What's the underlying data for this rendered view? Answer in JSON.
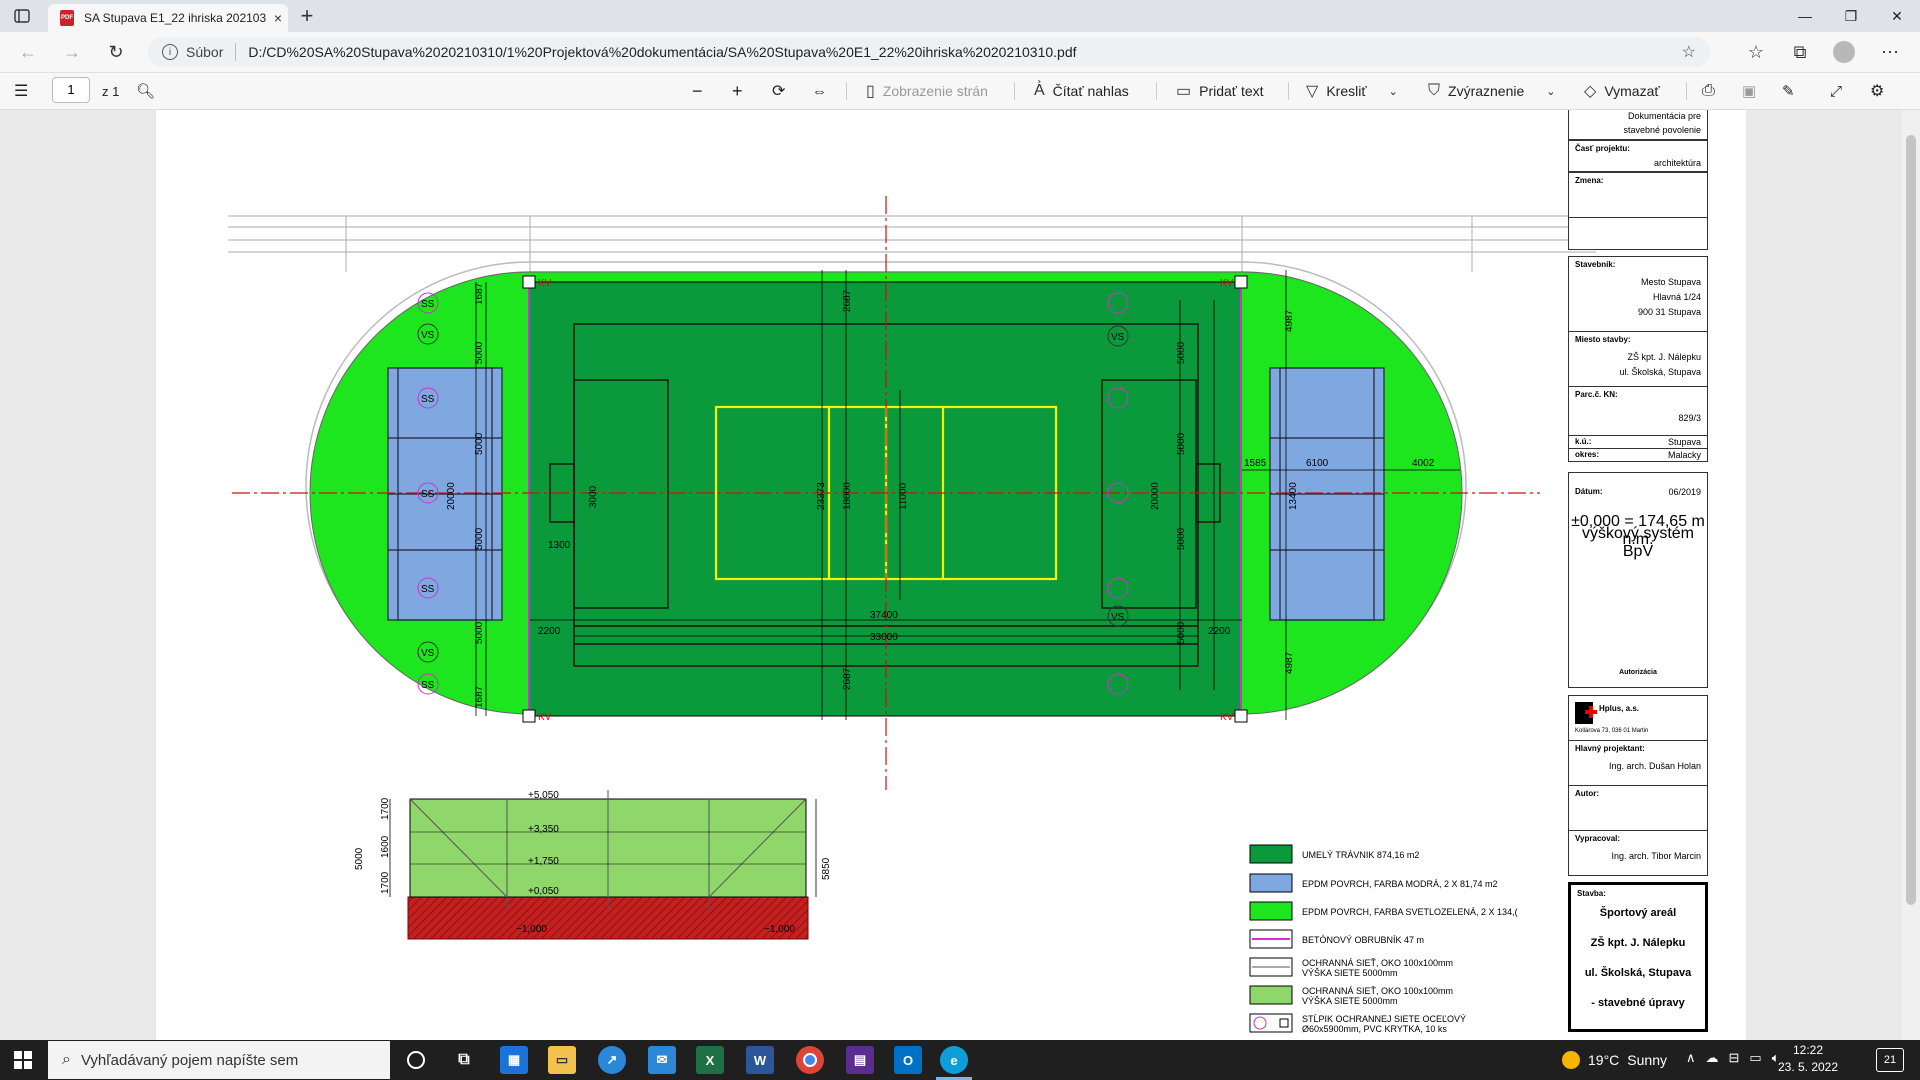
{
  "browser": {
    "tab_title": "SA Stupava E1_22 ihriska 202103",
    "tab_close": "×",
    "new_tab": "+",
    "url_label": "Súbor",
    "url": "D:/CD%20SA%20Stupava%2020210310/1%20Projektová%20dokumentácia/SA%20Stupava%20E1_22%20ihriska%2020210310.pdf"
  },
  "pdf_toolbar": {
    "page_number": "1",
    "page_total": "z 1",
    "page_view": "Zobrazenie strán",
    "read_aloud": "Čítať nahlas",
    "add_text": "Pridať text",
    "draw": "Kresliť",
    "highlight": "Zvýraznenie",
    "erase": "Vymazať"
  },
  "drawing": {
    "kv": "KV",
    "ss": "SS",
    "vs": "VS",
    "dims": {
      "d1687": "1687",
      "d5000": "5000",
      "d20000": "20000",
      "d3000": "3000",
      "d1300": "1300",
      "d2200": "2200",
      "d2687": "2687",
      "d23373": "23373",
      "d18000": "18000",
      "d11000": "11000",
      "d37400": "37400",
      "d33000": "33000",
      "d4987": "4987",
      "d1585": "1585",
      "d6100": "6100",
      "d4002": "4002",
      "d13400": "13400",
      "d5850": "5850",
      "d1700": "1700",
      "d1600": "1600"
    },
    "elev": {
      "e5050": "+5,050",
      "e3350": "+3,350",
      "e1750": "+1,750",
      "e0050": "+0,050",
      "em1000": "−1,000"
    },
    "legend": [
      {
        "color": "#0a9a3c",
        "text": "UMELÝ TRÁVNIK 874,16 m2"
      },
      {
        "color": "#80a8e0",
        "text": "EPDM POVRCH, FARBA MODRÁ, 2 X 81,74 m2"
      },
      {
        "color": "#1ee61e",
        "text": "EPDM POVRCH, FARBA SVETLOZELENÁ, 2 X 134,("
      },
      {
        "color": "#cc33cc",
        "text": "BETÓNOVÝ OBRUBNÍK 47 m"
      },
      {
        "color": "#555555",
        "text": "OCHRANNÁ SIEŤ, OKO 100x100mm",
        "text2": "VÝŠKA SIETE 5000mm"
      },
      {
        "color": "#8fd66b",
        "text": "OCHRANNÁ SIEŤ, OKO 100x100mm",
        "text2": "VÝŠKA SIETE 5000mm"
      },
      {
        "color": "#cc33cc",
        "text": "STĹPIK OCHRANNEJ SIETE OCEĽOVÝ",
        "text2": "Ø60x5900mm, PVC KRYTKA, 10 ks"
      }
    ]
  },
  "title_block": {
    "doc_type": "Dokumentácia pre",
    "doc_type2": "stavebné povolenie",
    "part_label": "Časť projektu:",
    "part_value": "architektúra",
    "change_label": "Zmena:",
    "investor_label": "Stavebník:",
    "investor_1": "Mesto Stupava",
    "investor_2": "Hlavná 1/24",
    "investor_3": "900 31 Stupava",
    "site_label": "Miesto stavby:",
    "site_1": "ZŠ kpt. J. Nálepku",
    "site_2": "ul. Školská, Stupava",
    "parcel_label": "Parc.č. KN:",
    "parcel_value": "829/3",
    "ku_label": "k.ú.:",
    "ku_value": "Stupava",
    "district_label": "okres:",
    "district_value": "Malacky",
    "date_label": "Dátum:",
    "date_value": "06/2019",
    "height_1": "±0,000 = 174,65 m n.m.",
    "height_2": "výškový systém BpV",
    "auth_label": "Autorizácia",
    "company": "Hplus, a.s.",
    "company_addr": "Kollárova 73, 036 01 Martin",
    "chief_label": "Hlavný projektant:",
    "chief_value": "Ing. arch. Dušan Holan",
    "author_label": "Autor:",
    "prepared_label": "Vypracoval:",
    "prepared_value": "Ing. arch. Tibor Marcin",
    "stavba_label": "Stavba:",
    "stavba_1": "Športový areál",
    "stavba_2": "ZŠ kpt. J. Nálepku",
    "stavba_3": "ul. Školská, Stupava",
    "stavba_4": "- stavebné úpravy"
  },
  "taskbar": {
    "search_placeholder": "Vyhľadávaný pojem napíšte sem",
    "temp": "19°C",
    "weather": "Sunny",
    "time": "12:22",
    "date": "23. 5. 2022",
    "notif": "21"
  }
}
